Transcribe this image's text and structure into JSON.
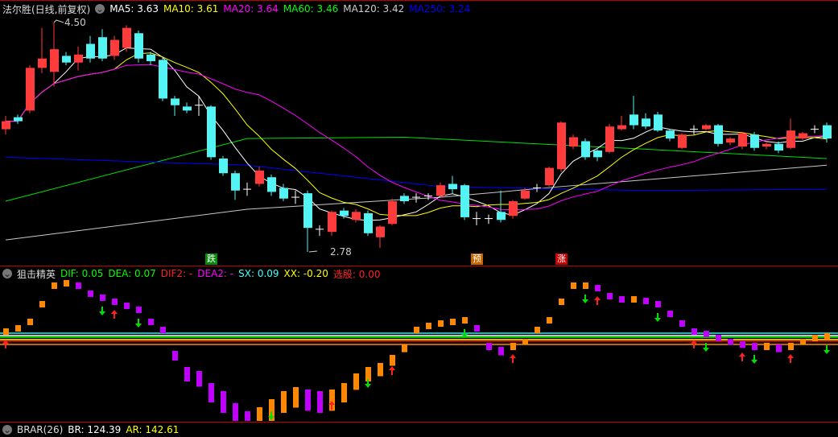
{
  "main_header": {
    "title": "法尔胜(日线,前复权)",
    "ma5": "MA5: 3.63",
    "ma10": "MA10: 3.61",
    "ma20": "MA20: 3.64",
    "ma60": "MA60: 3.46",
    "ma120": "MA120: 3.42",
    "ma250": "MA250: 3.24"
  },
  "ind_header": {
    "title": "狙击精英",
    "dif": "DIF: 0.05",
    "dea": "DEA: 0.07",
    "dif2": "DIF2: -",
    "dea2": "DEA2: -",
    "sx": "SX: 0.09",
    "xx": "XX: -0.20",
    "xg": "选股: 0.00"
  },
  "bottom_header": {
    "title": "BRAR(26)",
    "br": "BR: 124.39",
    "ar": "AR: 142.61"
  },
  "annotations": {
    "high": "4.50",
    "low": "2.78"
  },
  "signals": [
    {
      "label": "跌",
      "index": 17,
      "color": "#0a8a0a"
    },
    {
      "label": "预",
      "index": 39,
      "color": "#c86400"
    },
    {
      "label": "涨",
      "index": 46,
      "color": "#c80000"
    }
  ],
  "colors": {
    "up": "#ff3b3b",
    "down": "#54f4f4",
    "ma5": "#ffffff",
    "ma10": "#ffff00",
    "ma20": "#ff00ff",
    "ma60": "#00e000",
    "ma120": "#c8c8c8",
    "ma250": "#0000ff"
  },
  "candles": [
    [
      3.7,
      3.76,
      3.8,
      3.66
    ],
    [
      3.79,
      3.76,
      3.81,
      3.74
    ],
    [
      3.84,
      4.16,
      4.18,
      3.82
    ],
    [
      4.16,
      4.23,
      4.46,
      4.12
    ],
    [
      4.13,
      4.3,
      4.5,
      4.02
    ],
    [
      4.25,
      4.2,
      4.28,
      4.18
    ],
    [
      4.2,
      4.26,
      4.32,
      4.14
    ],
    [
      4.34,
      4.23,
      4.4,
      4.2
    ],
    [
      4.39,
      4.23,
      4.45,
      4.21
    ],
    [
      4.25,
      4.37,
      4.4,
      4.22
    ],
    [
      4.31,
      4.46,
      4.48,
      4.28
    ],
    [
      4.42,
      4.23,
      4.44,
      4.2
    ],
    [
      4.26,
      4.21,
      4.28,
      4.18
    ],
    [
      4.22,
      3.93,
      4.24,
      3.91
    ],
    [
      3.93,
      3.88,
      3.95,
      3.8
    ],
    [
      3.87,
      3.84,
      3.9,
      3.82
    ],
    [
      3.88,
      3.88,
      3.95,
      3.8
    ],
    [
      3.87,
      3.49,
      3.88,
      3.47
    ],
    [
      3.48,
      3.37,
      3.5,
      3.35
    ],
    [
      3.37,
      3.24,
      3.39,
      3.17
    ],
    [
      3.25,
      3.25,
      3.3,
      3.2
    ],
    [
      3.29,
      3.39,
      3.42,
      3.27
    ],
    [
      3.34,
      3.23,
      3.36,
      3.2
    ],
    [
      3.26,
      3.18,
      3.29,
      3.16
    ],
    [
      3.19,
      3.19,
      3.24,
      3.14
    ],
    [
      3.22,
      2.96,
      3.24,
      2.78
    ],
    [
      2.95,
      2.95,
      2.98,
      2.9
    ],
    [
      2.93,
      3.08,
      3.09,
      2.9
    ],
    [
      3.09,
      3.05,
      3.11,
      3.03
    ],
    [
      3.02,
      3.08,
      3.1,
      3.0
    ],
    [
      3.07,
      2.92,
      3.09,
      2.9
    ],
    [
      2.89,
      2.97,
      2.98,
      2.81
    ],
    [
      2.99,
      3.16,
      3.18,
      2.98
    ],
    [
      3.2,
      3.16,
      3.22,
      3.14
    ],
    [
      3.19,
      3.19,
      3.22,
      3.15
    ],
    [
      3.2,
      3.2,
      3.22,
      3.17
    ],
    [
      3.2,
      3.28,
      3.3,
      3.19
    ],
    [
      3.29,
      3.25,
      3.35,
      3.22
    ],
    [
      3.28,
      3.04,
      3.29,
      3.02
    ],
    [
      3.03,
      3.03,
      3.08,
      2.98
    ],
    [
      3.03,
      3.03,
      3.06,
      2.99
    ],
    [
      3.08,
      3.02,
      3.24,
      3.0
    ],
    [
      3.05,
      3.16,
      3.17,
      3.03
    ],
    [
      3.18,
      3.24,
      3.26,
      3.17
    ],
    [
      3.26,
      3.26,
      3.29,
      3.23
    ],
    [
      3.28,
      3.41,
      3.42,
      3.27
    ],
    [
      3.4,
      3.75,
      3.76,
      3.38
    ],
    [
      3.57,
      3.64,
      3.66,
      3.55
    ],
    [
      3.61,
      3.49,
      3.63,
      3.47
    ],
    [
      3.54,
      3.49,
      3.55,
      3.46
    ],
    [
      3.53,
      3.72,
      3.74,
      3.52
    ],
    [
      3.7,
      3.73,
      3.8,
      3.69
    ],
    [
      3.81,
      3.73,
      3.95,
      3.7
    ],
    [
      3.78,
      3.72,
      3.82,
      3.7
    ],
    [
      3.81,
      3.69,
      3.83,
      3.68
    ],
    [
      3.69,
      3.63,
      3.7,
      3.61
    ],
    [
      3.56,
      3.66,
      3.67,
      3.55
    ],
    [
      3.7,
      3.7,
      3.73,
      3.66
    ],
    [
      3.7,
      3.73,
      3.74,
      3.69
    ],
    [
      3.73,
      3.59,
      3.74,
      3.57
    ],
    [
      3.6,
      3.63,
      3.64,
      3.58
    ],
    [
      3.57,
      3.67,
      3.68,
      3.55
    ],
    [
      3.66,
      3.56,
      3.68,
      3.54
    ],
    [
      3.57,
      3.59,
      3.6,
      3.55
    ],
    [
      3.59,
      3.54,
      3.61,
      3.52
    ],
    [
      3.56,
      3.69,
      3.78,
      3.55
    ],
    [
      3.63,
      3.67,
      3.68,
      3.62
    ],
    [
      3.7,
      3.7,
      3.73,
      3.67
    ],
    [
      3.73,
      3.63,
      3.75,
      3.6
    ]
  ],
  "long_mas": {
    "ma60": [
      [
        0,
        3.16
      ],
      [
        20,
        3.63
      ],
      [
        33,
        3.64
      ],
      [
        53,
        3.55
      ],
      [
        68,
        3.48
      ]
    ],
    "ma120": [
      [
        0,
        2.87
      ],
      [
        20,
        3.1
      ],
      [
        36,
        3.19
      ],
      [
        46,
        3.27
      ],
      [
        68,
        3.43
      ]
    ],
    "ma250": [
      [
        0,
        3.49
      ],
      [
        20,
        3.43
      ],
      [
        36,
        3.27
      ],
      [
        53,
        3.24
      ],
      [
        68,
        3.25
      ]
    ]
  },
  "oscillator": [
    0.08,
    0.12,
    0.2,
    0.42,
    0.65,
    0.68,
    0.65,
    0.55,
    0.5,
    0.45,
    0.4,
    0.35,
    0.2,
    0.1,
    -0.2,
    -0.4,
    -0.45,
    -0.6,
    -0.7,
    -0.85,
    -0.95,
    -0.9,
    -0.8,
    -0.7,
    -0.65,
    -0.68,
    -0.7,
    -0.68,
    -0.6,
    -0.48,
    -0.4,
    -0.35,
    -0.25,
    -0.12,
    0.1,
    0.15,
    0.18,
    0.2,
    0.22,
    0.12,
    -0.1,
    -0.15,
    -0.1,
    -0.05,
    0.1,
    0.22,
    0.45,
    0.65,
    0.65,
    0.62,
    0.52,
    0.48,
    0.48,
    0.46,
    0.42,
    0.3,
    0.18,
    0.08,
    0.05,
    0.0,
    -0.05,
    -0.08,
    -0.1,
    -0.1,
    -0.12,
    -0.1,
    -0.05,
    0.0,
    0.02
  ],
  "buy_arrows": [
    0,
    9,
    27,
    32,
    42,
    49,
    57,
    61,
    65
  ],
  "sell_arrows": [
    8,
    11,
    22,
    30,
    38,
    48,
    54,
    58,
    62,
    68
  ]
}
